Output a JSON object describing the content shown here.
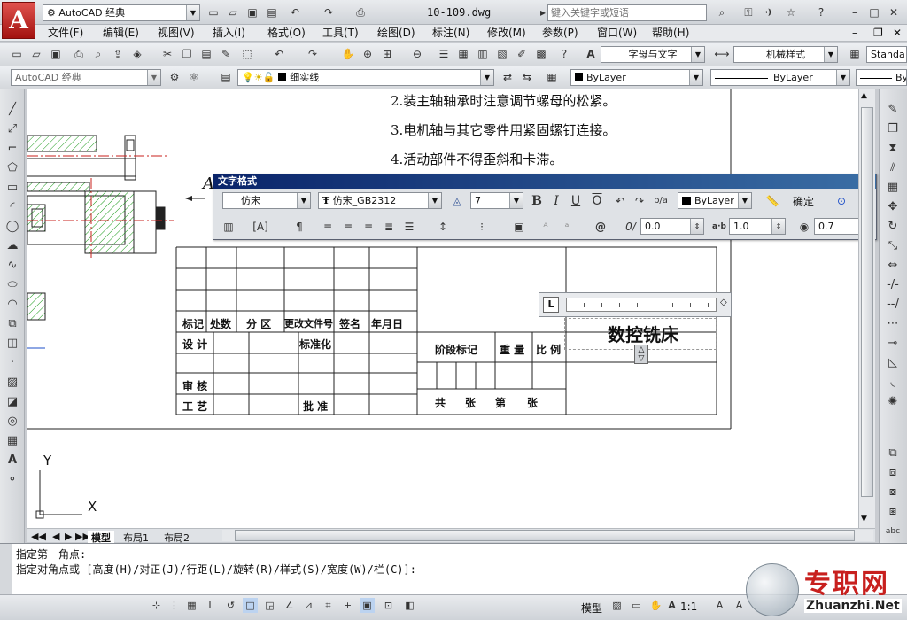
{
  "window": {
    "workspace_select": "AutoCAD 经典",
    "filename": "10-109.dwg",
    "search_placeholder": "键入关键字或短语",
    "help_icon": "question-icon"
  },
  "menu": [
    "文件(F)",
    "编辑(E)",
    "视图(V)",
    "插入(I)",
    "格式(O)",
    "工具(T)",
    "绘图(D)",
    "标注(N)",
    "修改(M)",
    "参数(P)",
    "窗口(W)",
    "帮助(H)"
  ],
  "toolbar2": {
    "text_style": "字母与文字",
    "dim_style": "机械样式",
    "table_style": "Standa"
  },
  "toolbar3": {
    "workspace": "AutoCAD 经典",
    "layer": "细实线",
    "color": "ByLayer",
    "linetype": "ByLayer",
    "lineweight": "By"
  },
  "text_format": {
    "title": "文字格式",
    "style": "仿宋",
    "font": "仿宋_GB2312",
    "height": "7",
    "bold": "B",
    "italic": "I",
    "underline": "U",
    "overline": "O",
    "color": "ByLayer",
    "ok": "确定",
    "oblique": "0.0",
    "tracking": "1.0",
    "width_factor": "0.7"
  },
  "drawing": {
    "notes": [
      "2.装主轴轴承时注意调节螺母的松紧。",
      "3.电机轴与其它零件用紧固螺钉连接。",
      "4.活动部件不得歪斜和卡滞。"
    ],
    "title_block": {
      "row_marks": [
        "标记",
        "处数",
        "分 区",
        "更改文件号",
        "签名",
        "年月日"
      ],
      "design": "设 计",
      "standard": "标准化",
      "review": "审 核",
      "process": "工 艺",
      "approve": "批 准",
      "stage": "阶段标记",
      "weight": "重 量",
      "scale": "比 例",
      "total": "共",
      "sheets1": "张",
      "page": "第",
      "sheets2": "张",
      "name": "数控铣床"
    },
    "ucs_y": "Y",
    "ucs_x": "X",
    "leader_letter": "A"
  },
  "tabs": [
    "模型",
    "布局1",
    "布局2"
  ],
  "command": {
    "line1": "指定第一角点:",
    "line2": "指定对角点或 [高度(H)/对正(J)/行距(L)/旋转(R)/样式(S)/宽度(W)/栏(C)]:"
  },
  "status": {
    "model": "模型",
    "scale": "1:1"
  },
  "watermark": {
    "cn": "专职网",
    "en": "Zhuanzhi.Net"
  },
  "colors": {
    "accent_red": "#c8201e",
    "drawing_bg": "#ffffff",
    "hatch_green": "#1a9a1a",
    "title_bar": "#0a246a"
  }
}
